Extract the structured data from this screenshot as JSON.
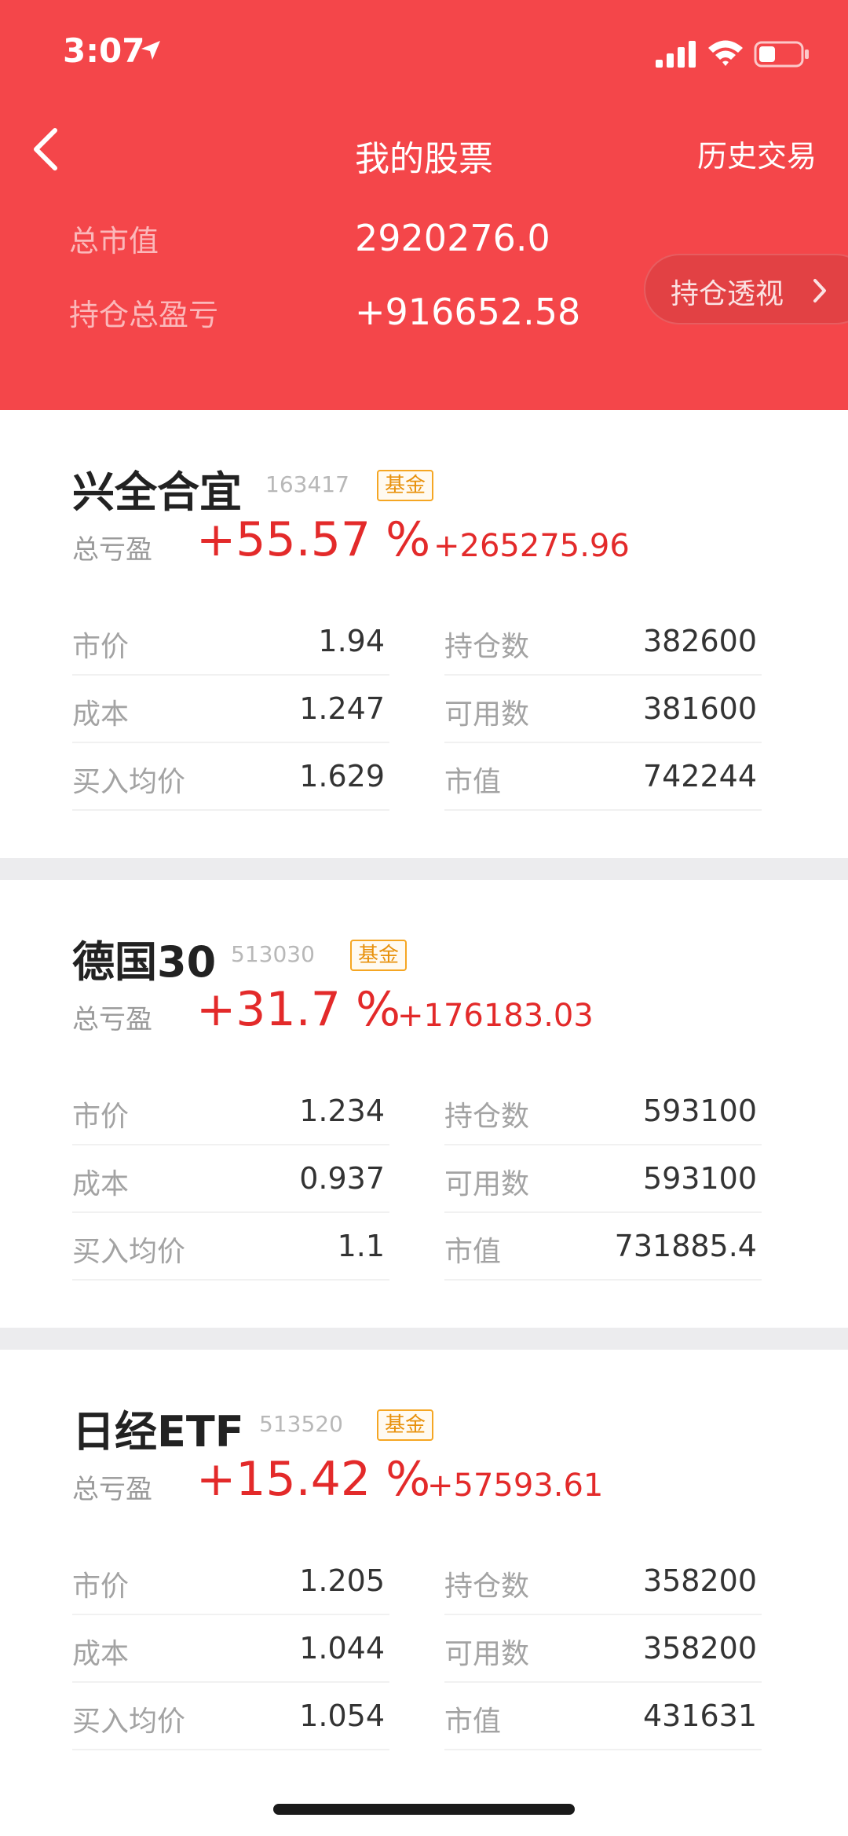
{
  "status": {
    "time": "3:07"
  },
  "nav": {
    "title": "我的股票",
    "right": "历史交易"
  },
  "summary": {
    "total_value_label": "总市值",
    "total_value": "2920276.0",
    "pnl_label": "持仓总盈亏",
    "pnl_value": "+916652.58",
    "analysis_button": "持仓透视"
  },
  "colors": {
    "header": "#f4464a",
    "gain": "#e32a2a",
    "badge": "#f5a623"
  },
  "holdings": [
    {
      "name": "兴全合宜",
      "code": "163417",
      "badge": "基金",
      "pnl_label": "总亏盈",
      "pnl_pct": "+55.57 %",
      "pnl_amount": "+265275.96",
      "left": [
        {
          "k": "市价",
          "v": "1.94"
        },
        {
          "k": "成本",
          "v": "1.247"
        },
        {
          "k": "买入均价",
          "v": "1.629"
        }
      ],
      "right": [
        {
          "k": "持仓数",
          "v": "382600"
        },
        {
          "k": "可用数",
          "v": "381600"
        },
        {
          "k": "市值",
          "v": "742244"
        }
      ]
    },
    {
      "name": "德国30",
      "code": "513030",
      "badge": "基金",
      "pnl_label": "总亏盈",
      "pnl_pct": "+31.7 %",
      "pnl_amount": "+176183.03",
      "left": [
        {
          "k": "市价",
          "v": "1.234"
        },
        {
          "k": "成本",
          "v": "0.937"
        },
        {
          "k": "买入均价",
          "v": "1.1"
        }
      ],
      "right": [
        {
          "k": "持仓数",
          "v": "593100"
        },
        {
          "k": "可用数",
          "v": "593100"
        },
        {
          "k": "市值",
          "v": "731885.4"
        }
      ]
    },
    {
      "name": "日经ETF",
      "code": "513520",
      "badge": "基金",
      "pnl_label": "总亏盈",
      "pnl_pct": "+15.42 %",
      "pnl_amount": "+57593.61",
      "left": [
        {
          "k": "市价",
          "v": "1.205"
        },
        {
          "k": "成本",
          "v": "1.044"
        },
        {
          "k": "买入均价",
          "v": "1.054"
        }
      ],
      "right": [
        {
          "k": "持仓数",
          "v": "358200"
        },
        {
          "k": "可用数",
          "v": "358200"
        },
        {
          "k": "市值",
          "v": "431631"
        }
      ]
    }
  ]
}
